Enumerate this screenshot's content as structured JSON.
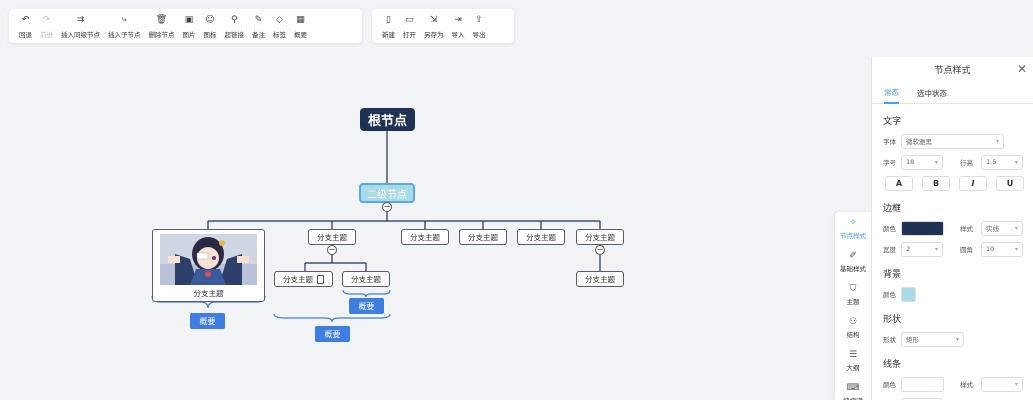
{
  "toolbar_left": [
    {
      "label": "回退",
      "icon": "undo-icon",
      "disabled": false
    },
    {
      "label": "前进",
      "icon": "redo-icon",
      "disabled": true
    },
    {
      "label": "插入同级节点",
      "icon": "insert-sibling-icon",
      "disabled": false
    },
    {
      "label": "插入子节点",
      "icon": "insert-child-icon",
      "disabled": false
    },
    {
      "label": "删除节点",
      "icon": "trash-icon",
      "disabled": false
    },
    {
      "label": "图片",
      "icon": "image-icon",
      "disabled": false
    },
    {
      "label": "图标",
      "icon": "smiley-icon",
      "disabled": false
    },
    {
      "label": "超链接",
      "icon": "link-icon",
      "disabled": false
    },
    {
      "label": "备注",
      "icon": "note-icon",
      "disabled": false
    },
    {
      "label": "标签",
      "icon": "tag-icon",
      "disabled": false
    },
    {
      "label": "概要",
      "icon": "summary-icon",
      "disabled": false
    }
  ],
  "toolbar_right": [
    {
      "label": "新建",
      "icon": "new-file-icon"
    },
    {
      "label": "打开",
      "icon": "folder-open-icon"
    },
    {
      "label": "另存为",
      "icon": "save-as-icon"
    },
    {
      "label": "导入",
      "icon": "import-icon"
    },
    {
      "label": "导出",
      "icon": "export-icon"
    }
  ],
  "mindmap": {
    "root": "根节点",
    "level2": "二级节点",
    "branch": "分支主题",
    "summary": "概要"
  },
  "panel": {
    "title": "节点样式",
    "tabs": [
      "常态",
      "选中状态"
    ],
    "text_section": "文字",
    "font_label": "字体",
    "font_value": "微软雅黑",
    "size_label": "字号",
    "size_value": "18",
    "lineheight_label": "行高",
    "lineheight_value": "1.5",
    "bold": "A",
    "bold2": "B",
    "italic": "I",
    "underline": "U",
    "border_section": "边框",
    "color_label": "颜色",
    "style_label": "样式",
    "border_style_value": "实线",
    "width_label": "宽度",
    "border_width_value": "2",
    "radius_label": "圆角",
    "radius_value": "10",
    "bg_section": "背景",
    "shape_section": "形状",
    "shape_label": "形状",
    "shape_value": "矩形",
    "line_section": "线条",
    "border_color": "#1f3254",
    "bg_color": "#a8dbe5"
  },
  "sidenav": [
    {
      "label": "节点样式",
      "icon": "node-style-icon",
      "active": true
    },
    {
      "label": "基础样式",
      "icon": "base-style-icon",
      "active": false
    },
    {
      "label": "主题",
      "icon": "theme-shirt-icon",
      "active": false
    },
    {
      "label": "结构",
      "icon": "structure-icon",
      "active": false
    },
    {
      "label": "大纲",
      "icon": "outline-icon",
      "active": false
    },
    {
      "label": "快捷键",
      "icon": "keyboard-icon",
      "active": false
    }
  ]
}
